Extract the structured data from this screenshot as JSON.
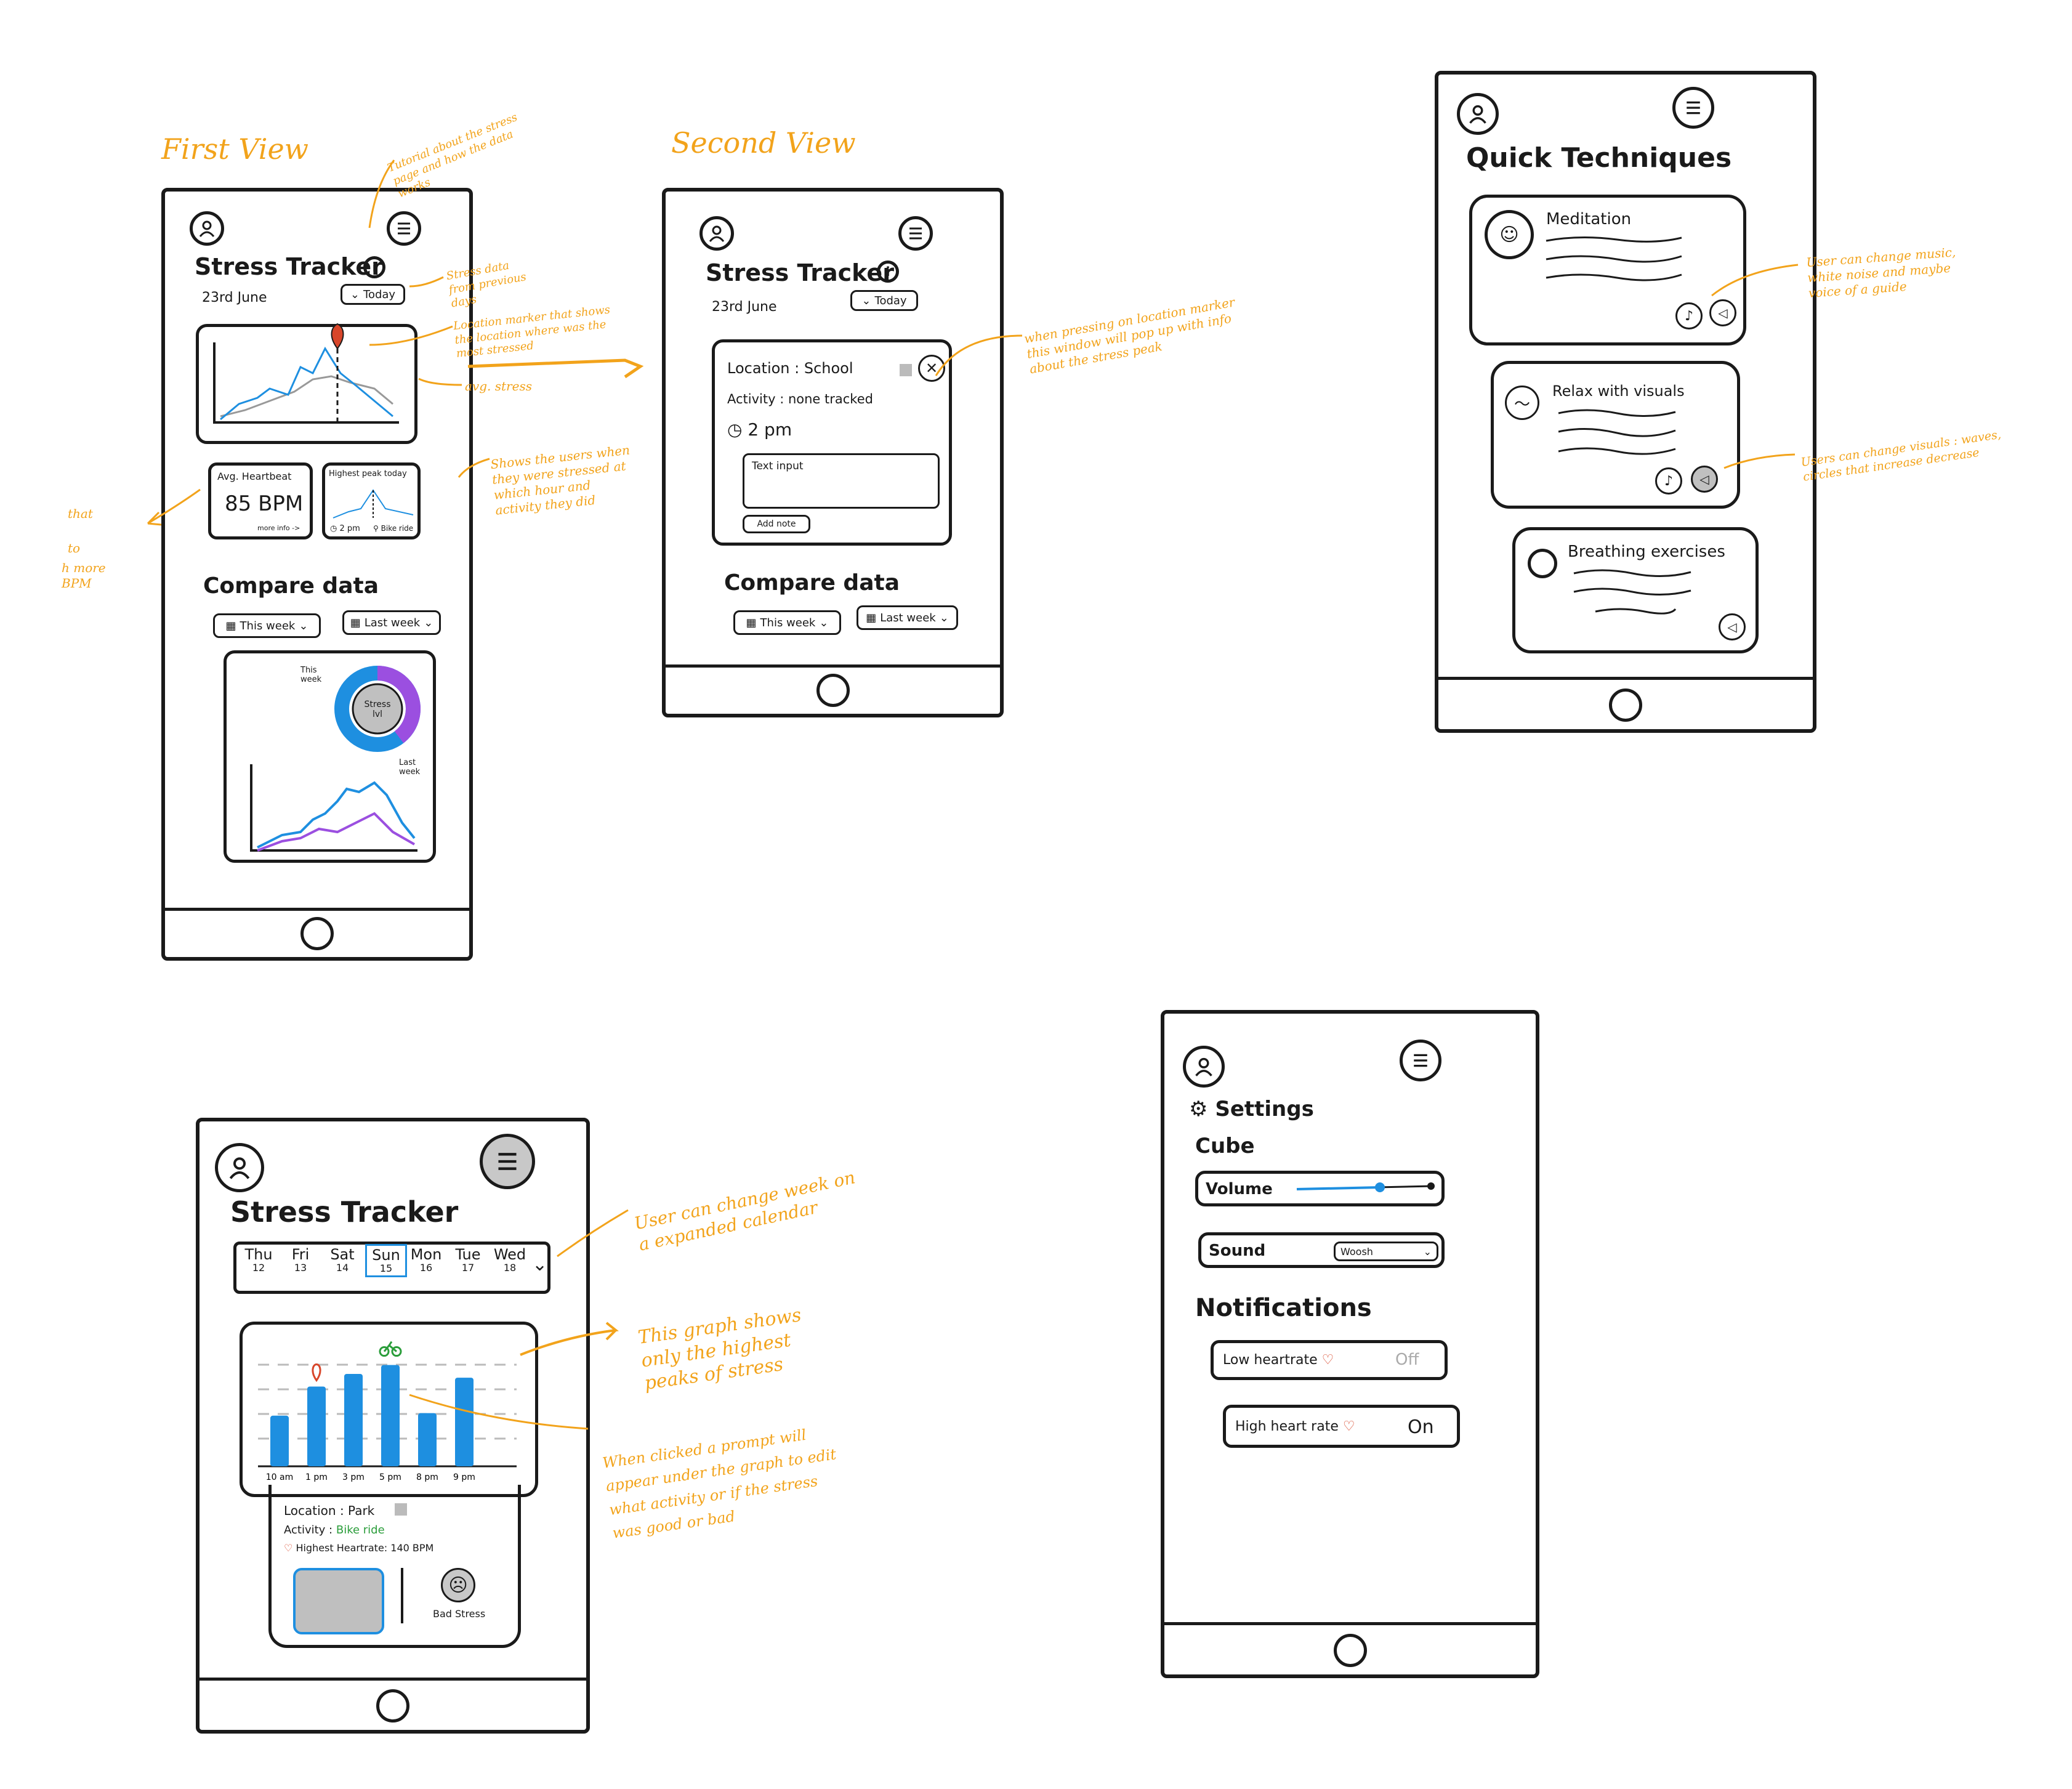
{
  "view_titles": {
    "first": "First View",
    "second": "Second View"
  },
  "first_view": {
    "title": "Stress Tracker",
    "date": "23rd June",
    "today_button": "Today",
    "avg_heartbeat_label": "Avg. Heartbeat",
    "avg_heartbeat_value": "85 BPM",
    "more_info": "more info ->",
    "highest_peak_label": "Highest peak today",
    "peak_time": "2 pm",
    "peak_activity": "Bike ride",
    "compare_title": "Compare data",
    "this_week_button": "This week",
    "last_week_button": "Last week",
    "donut_label_this_week": "This week",
    "donut_label_last_week": "Last week",
    "donut_center": "Stress lvl"
  },
  "second_view": {
    "title": "Stress Tracker",
    "date": "23rd June",
    "today_button": "Today",
    "location": "Location : School",
    "activity": "Activity : none tracked",
    "time": "2 pm",
    "text_input": "Text input",
    "add_note": "Add note",
    "compare_title": "Compare data",
    "this_week_button": "This week",
    "last_week_button": "Last week"
  },
  "quick_techniques": {
    "title": "Quick Techniques",
    "meditation": "Meditation",
    "relax_visuals": "Relax with visuals",
    "breathing": "Breathing exercises"
  },
  "calendar_view": {
    "title": "Stress Tracker",
    "days": [
      {
        "name": "Thu",
        "num": "12"
      },
      {
        "name": "Fri",
        "num": "13"
      },
      {
        "name": "Sat",
        "num": "14"
      },
      {
        "name": "Sun",
        "num": "15"
      },
      {
        "name": "Mon",
        "num": "16"
      },
      {
        "name": "Tue",
        "num": "17"
      },
      {
        "name": "Wed",
        "num": "18"
      }
    ],
    "bar_labels": [
      "10 am",
      "1 pm",
      "3 pm",
      "5 pm",
      "8 pm",
      "9 pm"
    ],
    "location": "Location : Park",
    "activity_label": "Activity :",
    "activity_value": "Bike ride",
    "highest_heartrate": "Highest Heartrate: 140 BPM",
    "bad_stress": "Bad Stress"
  },
  "settings_view": {
    "title": "Settings",
    "section_cube": "Cube",
    "volume": "Volume",
    "sound": "Sound",
    "sound_value": "Woosh",
    "section_notifications": "Notifications",
    "low_heartrate": "Low heartrate",
    "low_value": "Off",
    "high_heartrate": "High heart rate",
    "high_value": "On"
  },
  "annotations": {
    "tutorial": "Tutorial about the stress page and how the data works",
    "stress_prev_days": "Stress data from previous days",
    "location_marker": "Location marker that shows the location where was the most stressed",
    "avg_stress": "avg. stress",
    "shows_users": "Shows the users when they were stressed at which hour and activity they did",
    "left_fragment_1": "that",
    "left_fragment_2": "to",
    "left_fragment_3": "h more BPM",
    "pressing_marker": "when pressing on location marker this window will pop up with info about the stress peak",
    "change_music": "User can change music, white noise and maybe voice of a guide",
    "change_visuals": "Users can change visuals : waves, circles that increase decrease",
    "change_week": "User can change week on a expanded calendar",
    "graph_peaks": "This graph shows only the highest peaks of stress",
    "prompt": "When clicked a prompt will appear under the graph to edit what activity or if the stress was good or bad"
  },
  "colors": {
    "accent_orange": "#f2a31b",
    "blue": "#1e8fe0",
    "purple": "#9b4fe0",
    "green": "#2a9d3a",
    "red": "#d8462a"
  },
  "chart_data": {
    "type": "bar",
    "categories": [
      "10 am",
      "1 pm",
      "3 pm",
      "5 pm",
      "8 pm",
      "9 pm"
    ],
    "values": [
      40,
      63,
      73,
      80,
      42,
      70
    ],
    "ylim": [
      0,
      90
    ]
  }
}
